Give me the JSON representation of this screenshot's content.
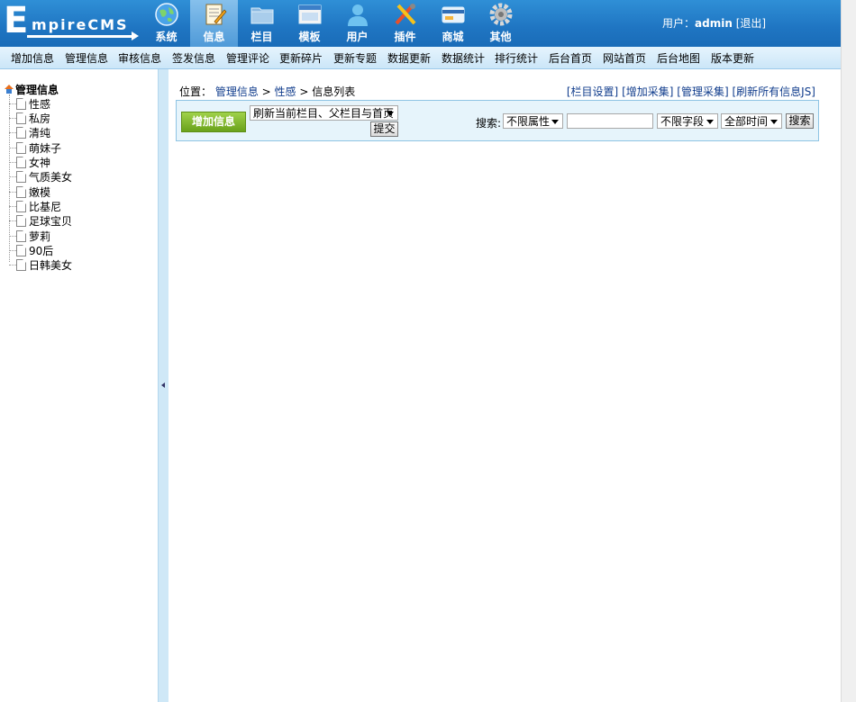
{
  "logo": {
    "first_letter": "E",
    "rest": "mpireCMS"
  },
  "main_nav": [
    {
      "label": "系统",
      "icon": "globe-icon"
    },
    {
      "label": "信息",
      "icon": "document-icon",
      "active": true
    },
    {
      "label": "栏目",
      "icon": "folder-icon"
    },
    {
      "label": "模板",
      "icon": "window-icon"
    },
    {
      "label": "用户",
      "icon": "user-icon"
    },
    {
      "label": "插件",
      "icon": "tools-icon"
    },
    {
      "label": "商城",
      "icon": "card-icon"
    },
    {
      "label": "其他",
      "icon": "gear-icon"
    }
  ],
  "user": {
    "prefix": "用户：",
    "name": "admin",
    "logout": "[退出]"
  },
  "sub_menu": [
    "增加信息",
    "管理信息",
    "审核信息",
    "签发信息",
    "管理评论",
    "更新碎片",
    "更新专题",
    "数据更新",
    "数据统计",
    "排行统计",
    "后台首页",
    "网站首页",
    "后台地图",
    "版本更新"
  ],
  "sidebar": {
    "root": "管理信息",
    "items": [
      "性感",
      "私房",
      "清纯",
      "萌妹子",
      "女神",
      "气质美女",
      "嫩模",
      "比基尼",
      "足球宝贝",
      "萝莉",
      "90后",
      "日韩美女"
    ]
  },
  "breadcrumb": {
    "prefix": "位置：",
    "level1": "管理信息",
    "sep": " > ",
    "level2": "性感",
    "current": "信息列表"
  },
  "top_links": [
    "[栏目设置]",
    "[增加采集]",
    "[管理采集]",
    "[刷新所有信息JS]"
  ],
  "toolbar": {
    "add_button": "增加信息",
    "refresh_select": "刷新当前栏目、父栏目与首页",
    "submit_button": "提交",
    "search_label": "搜索:",
    "attr_select": "不限属性",
    "search_value": "",
    "field_select": "不限字段",
    "time_select": "全部时间",
    "search_button": "搜索"
  },
  "colors": {
    "header": "#1f75c2",
    "submenu": "#d7edfb",
    "add_button": "#7cb327",
    "link": "#103c8c"
  }
}
